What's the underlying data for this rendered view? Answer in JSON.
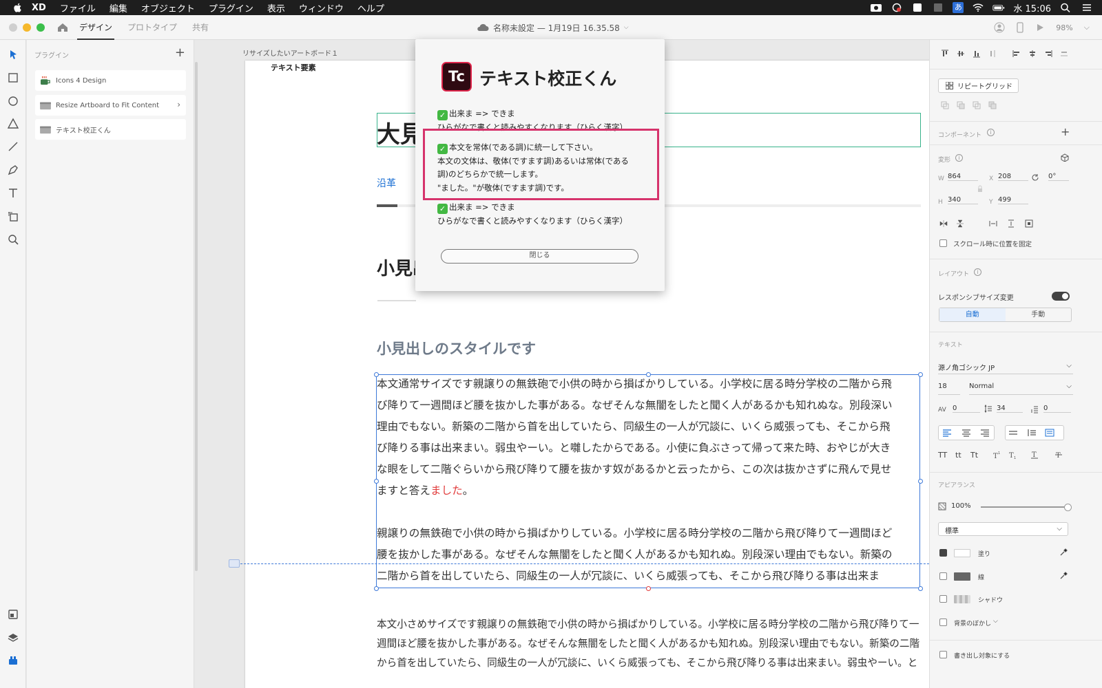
{
  "menubar": {
    "app": "XD",
    "items": [
      "ファイル",
      "編集",
      "オブジェクト",
      "プラグイン",
      "表示",
      "ウィンドウ",
      "ヘルプ"
    ],
    "clock": "水 15:06",
    "input_method": "あ"
  },
  "titlebar": {
    "tabs": [
      "デザイン",
      "プロトタイプ",
      "共有"
    ],
    "doc_title": "名称未設定 — 1月19日 16.35.58",
    "zoom": "98%"
  },
  "plugins": {
    "header": "プラグイン",
    "items": [
      {
        "name": "Icons 4 Design"
      },
      {
        "name": "Resize Artboard to Fit Content"
      },
      {
        "name": "テキスト校正くん"
      }
    ]
  },
  "canvas": {
    "artboard_name": "リサイズしたいアートボード１",
    "text_element_label": "テキスト要素",
    "h1": "大見",
    "nav_link": "沿革",
    "h2": "小見出",
    "h3": "小見出しのスタイルです",
    "body1_lines": [
      "本文通常サイズです親譲りの無鉄砲で小供の時から損ばかりしている。小学校に居る時分学校の二階から飛",
      "び降りて一週間ほど腰を抜かした事がある。なぜそんな無闇をしたと聞く人があるかも知れぬな。別段深い",
      "理由でもない。新築の二階から首を出していたら、同級生の一人が冗談に、いくら威張っても、そこから飛",
      "び降りる事は出来まい。弱虫やーい。と囃したからである。小使に負ぶさって帰って来た時、おやじが大き",
      "な眼をして二階ぐらいから飛び降りて腰を抜かす奴があるかと云ったから、この次は抜かさずに飛んで見せ"
    ],
    "body1_last_pre": "ますと答え",
    "body1_last_red": "ました",
    "body1_last_post": "。",
    "body1b_lines": [
      "親譲りの無鉄砲で小供の時から損ばかりしている。小学校に居る時分学校の二階から飛び降りて一週間ほど",
      "腰を抜かした事がある。なぜそんな無闇をしたと聞く人があるかも知れぬ。別段深い理由でもない。新築の",
      "二階から首を出していたら、同級生の一人が冗談に、いくら威張っても、そこから飛び降りる事は出来ま"
    ],
    "body2_lines": [
      "本文小さめサイズです親譲りの無鉄砲で小供の時から損ばかりしている。小学校に居る時分学校の二階から飛び降りて一",
      "週間ほど腰を抜かした事がある。なぜそんな無闇をしたと聞く人があるかも知れぬ。別段深い理由でもない。新築の二階",
      "から首を出していたら、同級生の一人が冗談に、いくら威張っても、そこから飛び降りる事は出来まい。弱虫やーい。と"
    ]
  },
  "dialog": {
    "icon": "Tc",
    "title": "テキスト校正くん",
    "m1_title": "出来ま => できま",
    "m1_body": "ひらがなで書くと読みやすくなります（ひらく漢字）",
    "m2_title": "本文を常体(である調)に統一して下さい。",
    "m2_l1": "本文の文体は、敬体(ですます調)あるいは常体(である",
    "m2_l2": "調)のどちらかで統一します。",
    "m2_l3": "\"ました。\"が敬体(ですます調)です。",
    "m3_title": "出来ま => できま",
    "m3_body": "ひらがなで書くと読みやすくなります（ひらく漢字）",
    "close": "閉じる"
  },
  "props": {
    "repeat_grid": "リピートグリッド",
    "component": "コンポーネント",
    "transform": "変形",
    "w_lbl": "W",
    "w": "864",
    "x_lbl": "X",
    "x": "208",
    "rot": "0°",
    "h_lbl": "H",
    "h": "340",
    "y_lbl": "Y",
    "y": "499",
    "fix_scroll": "スクロール時に位置を固定",
    "layout": "レイアウト",
    "responsive": "レスポンシブサイズ変更",
    "auto": "自動",
    "manual": "手動",
    "text": "テキスト",
    "font": "源ノ角ゴシック JP",
    "size": "18",
    "weight": "Normal",
    "tracking": "0",
    "leading": "34",
    "para": "0",
    "tt1": "TT",
    "tt2": "tt",
    "tt3": "Tt",
    "appearance": "アピアランス",
    "opacity": "100%",
    "blend": "標準",
    "fill": "塗り",
    "stroke": "線",
    "shadow": "シャドウ",
    "bgblur": "背景のぼかし",
    "export": "書き出し対象にする"
  },
  "colors": {
    "accent": "#1b6fd3",
    "highlight": "#d6336c",
    "error_text": "#e13c3c",
    "check": "#43b843"
  }
}
